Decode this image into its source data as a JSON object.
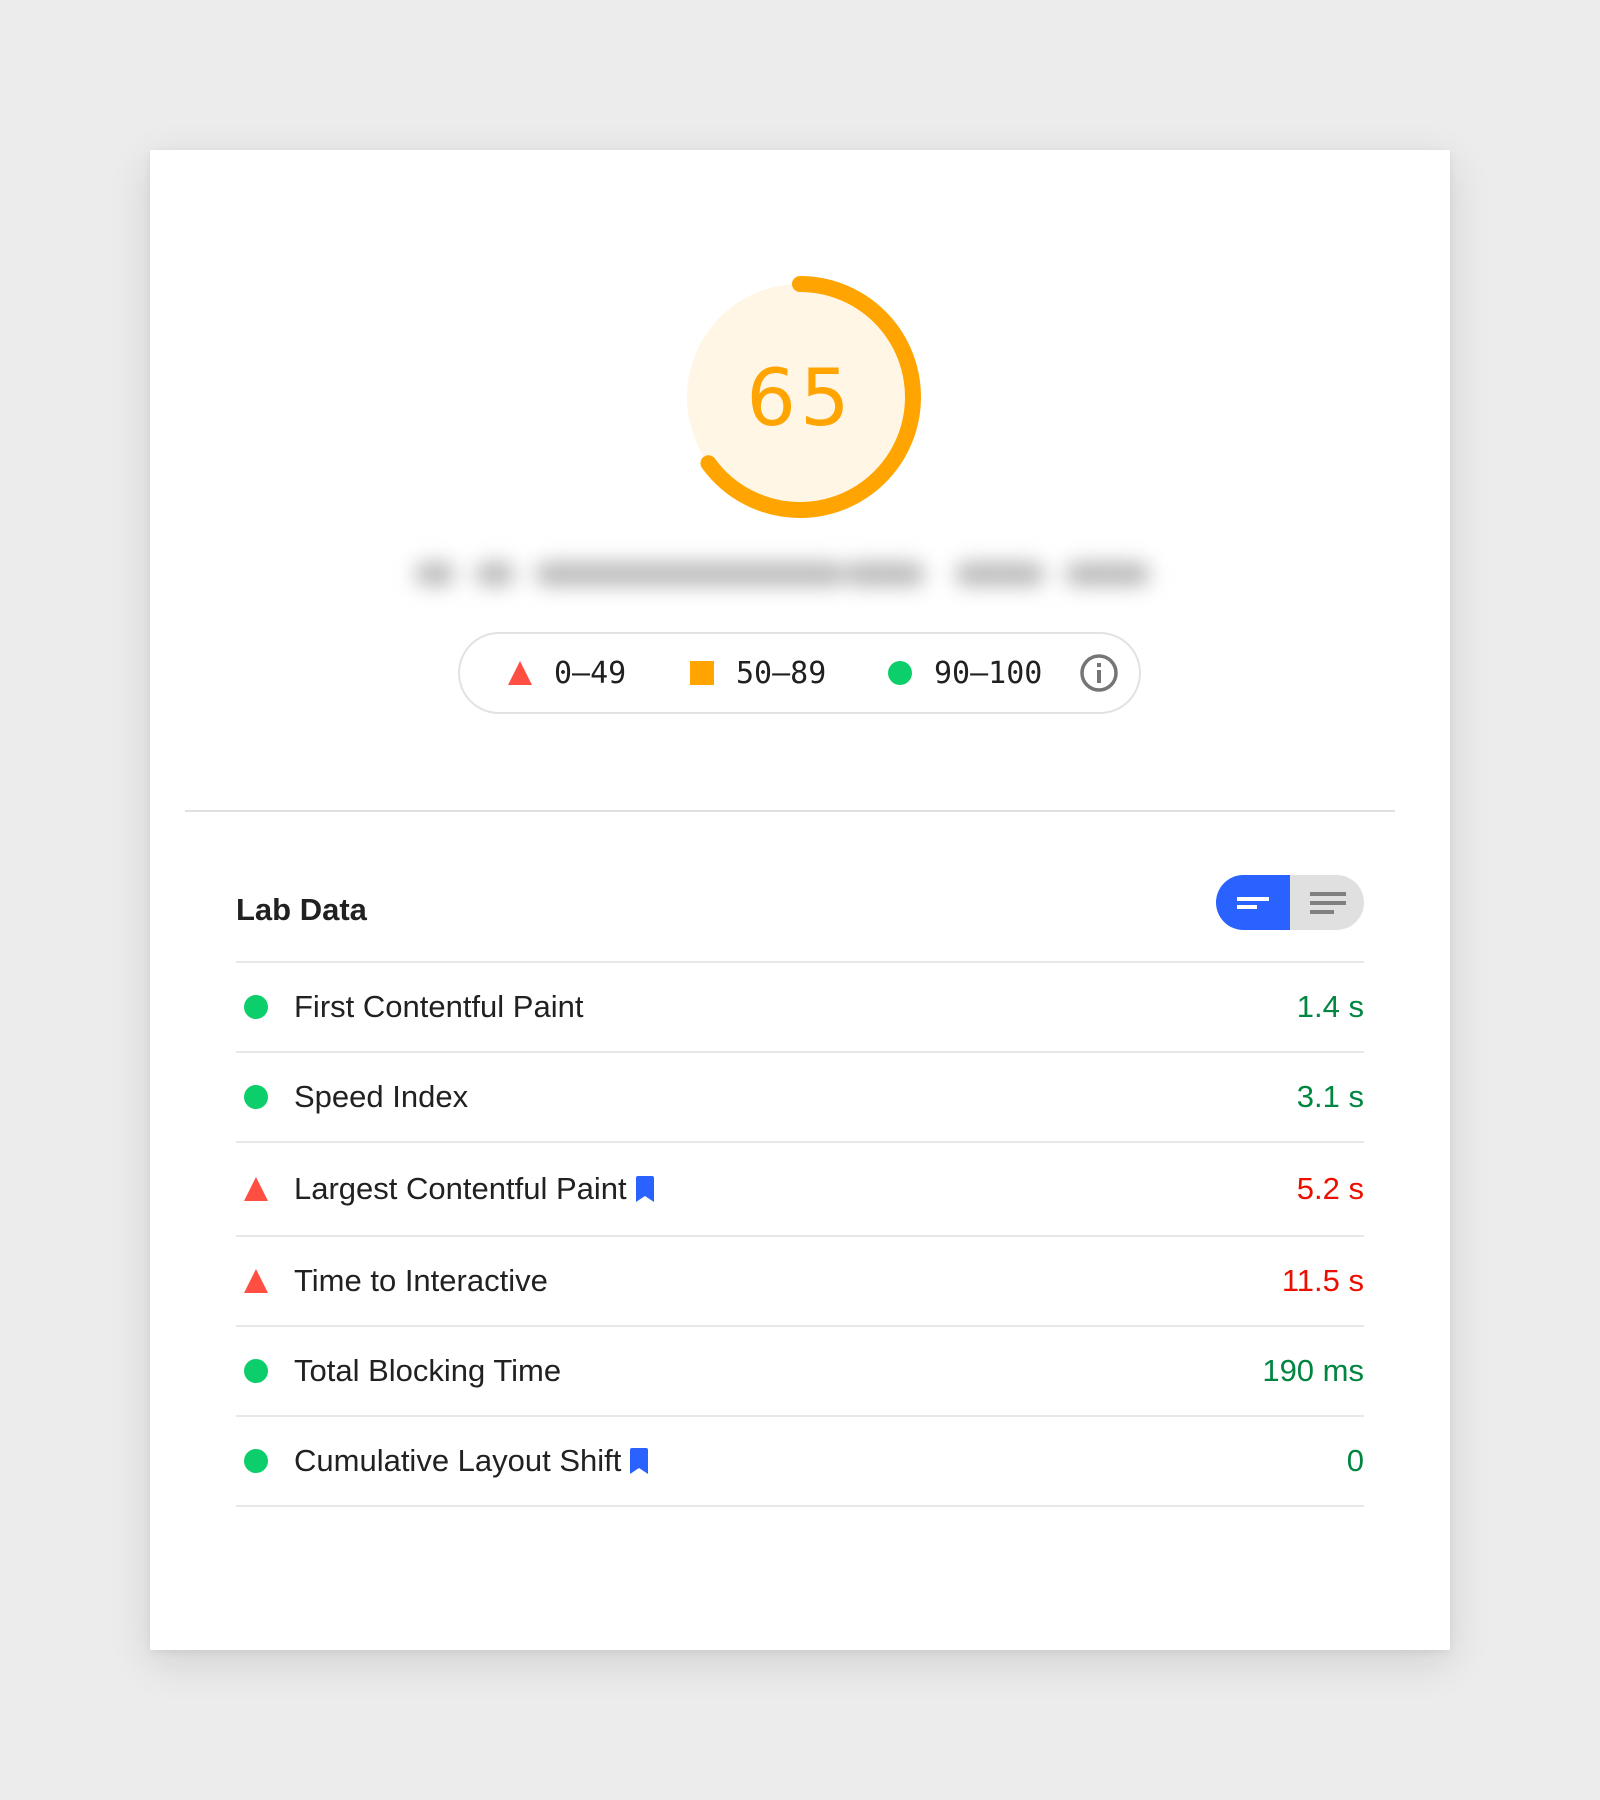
{
  "score": {
    "value": "65",
    "fraction": 0.65,
    "color": "#ffa400",
    "background_color": "#fff6e6"
  },
  "url": {
    "redacted": true
  },
  "legend": {
    "items": [
      {
        "icon": "triangle-icon",
        "label": "0–49",
        "color": "#ff4e42"
      },
      {
        "icon": "square-icon",
        "label": "50–89",
        "color": "#ffa400"
      },
      {
        "icon": "circle-icon",
        "label": "90–100",
        "color": "#0cce6b"
      }
    ],
    "info_icon": "info-icon"
  },
  "lab_data": {
    "title": "Lab Data",
    "toggle": {
      "options": [
        {
          "icon": "compact-view-icon",
          "active": true
        },
        {
          "icon": "expanded-view-icon",
          "active": false
        }
      ],
      "active_color": "#2962ff"
    },
    "metrics": [
      {
        "name": "First Contentful Paint",
        "value": "1.4 s",
        "status": "pass",
        "bookmark": false
      },
      {
        "name": "Speed Index",
        "value": "3.1 s",
        "status": "pass",
        "bookmark": false
      },
      {
        "name": "Largest Contentful Paint",
        "value": "5.2 s",
        "status": "fail",
        "bookmark": true
      },
      {
        "name": "Time to Interactive",
        "value": "11.5 s",
        "status": "fail",
        "bookmark": false
      },
      {
        "name": "Total Blocking Time",
        "value": "190 ms",
        "status": "pass",
        "bookmark": false
      },
      {
        "name": "Cumulative Layout Shift",
        "value": "0",
        "status": "pass",
        "bookmark": true
      }
    ]
  },
  "colors": {
    "pass_text": "#018642",
    "fail_text": "#eb0f00",
    "pass_icon": "#0cce6b",
    "fail_icon": "#ff4e42",
    "bookmark": "#2962ff"
  }
}
